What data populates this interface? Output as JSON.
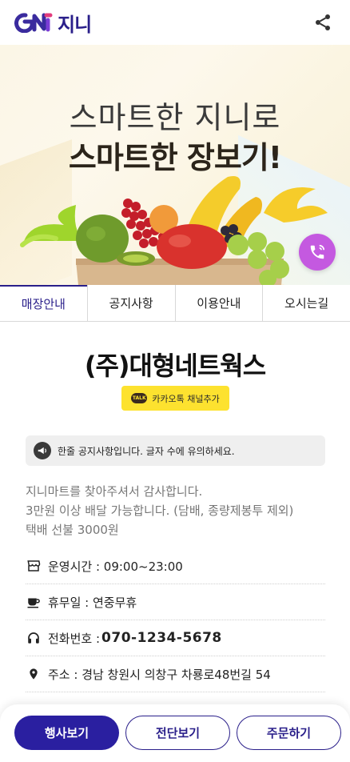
{
  "header": {
    "logo_text": "지니",
    "share_icon": "share-icon"
  },
  "banner": {
    "line1": "스마트한 지니로",
    "line2": "스마트한 장보기!",
    "call_icon": "phone-call-icon"
  },
  "tabs": [
    {
      "label": "매장안내",
      "active": true
    },
    {
      "label": "공지사항",
      "active": false
    },
    {
      "label": "이용안내",
      "active": false
    },
    {
      "label": "오시는길",
      "active": false
    }
  ],
  "store": {
    "name": "(주)대형네트웍스",
    "kakao_label": "카카오톡 채널추가",
    "kakao_logo_text": "TALK"
  },
  "notice": {
    "text": "한줄 공지사항입니다. 글자 수에 유의하세요.",
    "icon": "megaphone-icon"
  },
  "description": [
    "지니마트를 찾아주셔서 감사합니다.",
    "3만원 이상 배달 가능합니다. (담배, 종량제봉투 제외)",
    "택배 선불 3000원"
  ],
  "info": {
    "hours": {
      "label": "운영시간 : 09:00~23:00",
      "icon": "store-icon"
    },
    "holiday": {
      "label": "휴무일 : 연중무휴",
      "icon": "coffee-cup-icon"
    },
    "phone": {
      "label": "전화번호 : ",
      "value": "070-1234-5678",
      "icon": "headset-icon"
    },
    "address": {
      "label": "주소 : 경남 창원시 의창구 차룡로48번길 54",
      "icon": "location-pin-icon"
    }
  },
  "bottom_bar": {
    "event_label": "행사보기",
    "flyer_label": "전단보기",
    "order_label": "주문하기"
  },
  "colors": {
    "brand": "#2a1f8a",
    "primary_button": "#2a1fa0",
    "call_fab": "#c459e0",
    "kakao": "#fde22f"
  }
}
